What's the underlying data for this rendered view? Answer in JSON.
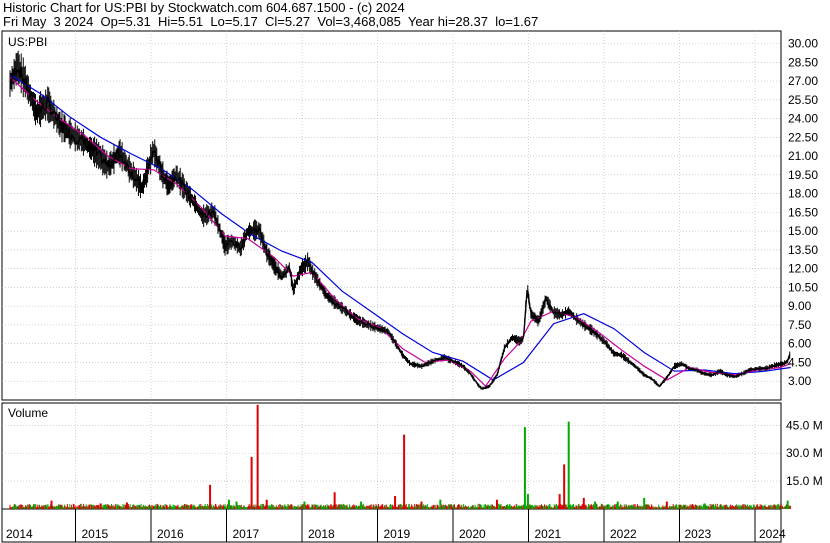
{
  "header": {
    "line1": "Historic Chart for US:PBI by Stockwatch.com 604.687.1500 - (c) 2024",
    "line2": "Fri May  3 2024  Op=5.31  Hi=5.51  Lo=5.17  Cl=5.27  Vol=3,468,085  Year hi=28.37  lo=1.67"
  },
  "colors": {
    "price": "#000000",
    "ma_short": "#cc0099",
    "ma_long": "#0000dd",
    "vol_down": "#dd0000",
    "vol_up": "#00aa00",
    "grid": "#b4b4b4"
  },
  "chart_data": [
    {
      "type": "line",
      "panel_label": "US:PBI",
      "x_tick_labels": [
        "2014",
        "2015",
        "2016",
        "2017",
        "2018",
        "2019",
        "2020",
        "2021",
        "2022",
        "2023",
        "2024"
      ],
      "y_ticks": [
        3.0,
        4.5,
        6.0,
        7.5,
        9.0,
        10.5,
        12.0,
        13.5,
        15.0,
        16.5,
        18.0,
        19.5,
        21.0,
        22.5,
        24.0,
        25.5,
        27.0,
        28.5,
        30.0
      ],
      "y_tick_labels": [
        "3.00",
        "4.50",
        "6.00",
        "7.50",
        "9.00",
        "10.50",
        "12.00",
        "13.50",
        "15.00",
        "16.50",
        "18.00",
        "19.50",
        "21.00",
        "22.50",
        "24.00",
        "25.50",
        "27.00",
        "28.50",
        "30.00"
      ],
      "ylim": [
        1.5,
        31.0
      ],
      "grid": true,
      "series": [
        {
          "role": "price",
          "x": [
            2014.0,
            2014.1,
            2014.2,
            2014.35,
            2014.5,
            2014.65,
            2014.8,
            2015.0,
            2015.15,
            2015.3,
            2015.45,
            2015.6,
            2015.75,
            2015.9,
            2016.0,
            2016.1,
            2016.2,
            2016.3,
            2016.45,
            2016.55,
            2016.7,
            2016.85,
            2016.95,
            2017.05,
            2017.15,
            2017.3,
            2017.4,
            2017.5,
            2017.6,
            2017.7,
            2017.75,
            2017.85,
            2017.95,
            2018.0,
            2018.1,
            2018.2,
            2018.3,
            2018.45,
            2018.6,
            2018.75,
            2018.9,
            2019.0,
            2019.1,
            2019.2,
            2019.3,
            2019.45,
            2019.6,
            2019.75,
            2019.9,
            2020.0,
            2020.1,
            2020.2,
            2020.25,
            2020.35,
            2020.45,
            2020.55,
            2020.65,
            2020.75,
            2020.8,
            2020.85,
            2020.9,
            2021.0,
            2021.1,
            2021.2,
            2021.3,
            2021.4,
            2021.5,
            2021.6,
            2021.7,
            2021.8,
            2021.9,
            2022.0,
            2022.1,
            2022.2,
            2022.3,
            2022.4,
            2022.5,
            2022.6,
            2022.7,
            2022.8,
            2022.9,
            2023.0,
            2023.1,
            2023.2,
            2023.3,
            2023.4,
            2023.5,
            2023.6,
            2023.7,
            2023.8,
            2023.9,
            2024.0,
            2024.15,
            2024.25,
            2024.3,
            2024.34
          ],
          "values": [
            26.8,
            28.2,
            27.0,
            24.5,
            25.2,
            23.6,
            22.8,
            22.0,
            21.2,
            20.2,
            21.3,
            19.8,
            18.4,
            21.5,
            19.8,
            18.6,
            19.5,
            18.5,
            17.2,
            16.2,
            16.5,
            13.8,
            14.2,
            13.6,
            15.0,
            15.1,
            13.3,
            12.2,
            11.4,
            12.1,
            10.3,
            11.9,
            12.6,
            11.8,
            10.8,
            9.8,
            9.3,
            8.6,
            7.9,
            7.5,
            7.2,
            7.0,
            6.1,
            5.1,
            4.4,
            4.2,
            4.6,
            4.9,
            4.5,
            4.2,
            3.6,
            2.7,
            2.4,
            2.6,
            3.5,
            5.7,
            6.5,
            6.2,
            6.4,
            10.5,
            8.4,
            7.8,
            9.6,
            8.5,
            8.3,
            8.6,
            8.0,
            7.5,
            7.1,
            6.6,
            6.0,
            5.2,
            5.1,
            4.6,
            4.1,
            3.5,
            3.2,
            2.6,
            3.3,
            4.2,
            4.4,
            4.0,
            3.9,
            3.6,
            3.5,
            3.8,
            3.5,
            3.4,
            3.6,
            3.9,
            4.0,
            4.0,
            4.3,
            4.4,
            4.6,
            5.3
          ]
        },
        {
          "role": "moving-average-short",
          "x": [
            2014.0,
            2014.35,
            2014.65,
            2015.0,
            2015.3,
            2015.6,
            2015.9,
            2016.2,
            2016.55,
            2016.85,
            2017.15,
            2017.5,
            2017.75,
            2018.0,
            2018.3,
            2018.6,
            2018.9,
            2019.2,
            2019.5,
            2019.8,
            2020.1,
            2020.3,
            2020.55,
            2020.75,
            2020.9,
            2021.2,
            2021.5,
            2021.8,
            2022.1,
            2022.4,
            2022.7,
            2023.0,
            2023.3,
            2023.6,
            2023.9,
            2024.2,
            2024.34
          ],
          "values": [
            27.3,
            25.4,
            24.0,
            22.6,
            21.0,
            20.0,
            19.9,
            18.8,
            16.8,
            14.6,
            14.4,
            12.9,
            11.4,
            11.7,
            9.6,
            8.0,
            7.3,
            5.6,
            4.5,
            4.7,
            3.8,
            2.6,
            4.8,
            6.1,
            7.8,
            8.6,
            8.1,
            6.9,
            5.5,
            4.2,
            3.1,
            4.1,
            3.7,
            3.5,
            3.9,
            4.1,
            4.4
          ]
        },
        {
          "role": "moving-average-long",
          "x": [
            2014.0,
            2014.4,
            2014.8,
            2015.2,
            2015.6,
            2016.0,
            2016.4,
            2016.8,
            2017.2,
            2017.6,
            2018.0,
            2018.4,
            2018.8,
            2019.2,
            2019.6,
            2020.0,
            2020.4,
            2020.8,
            2021.2,
            2021.6,
            2022.0,
            2022.4,
            2022.8,
            2023.2,
            2023.6,
            2024.0,
            2024.34
          ],
          "values": [
            27.5,
            26.0,
            24.1,
            22.5,
            21.2,
            20.0,
            18.4,
            16.4,
            14.7,
            13.4,
            12.5,
            10.2,
            8.5,
            6.8,
            5.3,
            4.6,
            3.1,
            4.5,
            7.6,
            8.4,
            7.2,
            5.3,
            3.8,
            3.9,
            3.6,
            3.8,
            4.1
          ]
        }
      ]
    },
    {
      "type": "bar",
      "panel_label": "Volume",
      "y_ticks": [
        15.0,
        30.0,
        45.0
      ],
      "y_tick_labels": [
        "15.0 M",
        "30.0 M",
        "45.0 M"
      ],
      "ylim": [
        0,
        57
      ],
      "grid": true,
      "spikes": [
        {
          "x": 2014.55,
          "value": 4.5,
          "dir": "down"
        },
        {
          "x": 2015.2,
          "value": 3.0,
          "dir": "down"
        },
        {
          "x": 2015.55,
          "value": 3.5,
          "dir": "down"
        },
        {
          "x": 2016.65,
          "value": 13.0,
          "dir": "down"
        },
        {
          "x": 2016.9,
          "value": 5.0,
          "dir": "up"
        },
        {
          "x": 2017.0,
          "value": 4.0,
          "dir": "up"
        },
        {
          "x": 2017.2,
          "value": 28.0,
          "dir": "down"
        },
        {
          "x": 2017.28,
          "value": 56.0,
          "dir": "down"
        },
        {
          "x": 2017.4,
          "value": 5.0,
          "dir": "down"
        },
        {
          "x": 2017.9,
          "value": 4.0,
          "dir": "up"
        },
        {
          "x": 2018.3,
          "value": 9.0,
          "dir": "down"
        },
        {
          "x": 2018.65,
          "value": 4.0,
          "dir": "up"
        },
        {
          "x": 2019.1,
          "value": 7.0,
          "dir": "down"
        },
        {
          "x": 2019.22,
          "value": 40.0,
          "dir": "down"
        },
        {
          "x": 2019.45,
          "value": 4.0,
          "dir": "down"
        },
        {
          "x": 2019.7,
          "value": 5.0,
          "dir": "up"
        },
        {
          "x": 2020.45,
          "value": 5.0,
          "dir": "down"
        },
        {
          "x": 2020.82,
          "value": 44.0,
          "dir": "up"
        },
        {
          "x": 2020.86,
          "value": 8.0,
          "dir": "up"
        },
        {
          "x": 2021.28,
          "value": 8.0,
          "dir": "down"
        },
        {
          "x": 2021.4,
          "value": 47.0,
          "dir": "up"
        },
        {
          "x": 2021.34,
          "value": 24.0,
          "dir": "down"
        },
        {
          "x": 2021.6,
          "value": 6.0,
          "dir": "down"
        },
        {
          "x": 2021.75,
          "value": 4.0,
          "dir": "up"
        },
        {
          "x": 2022.05,
          "value": 4.0,
          "dir": "up"
        },
        {
          "x": 2022.4,
          "value": 6.0,
          "dir": "up"
        },
        {
          "x": 2022.7,
          "value": 4.0,
          "dir": "down"
        },
        {
          "x": 2023.2,
          "value": 3.0,
          "dir": "up"
        },
        {
          "x": 2024.3,
          "value": 4.5,
          "dir": "up"
        }
      ]
    }
  ]
}
